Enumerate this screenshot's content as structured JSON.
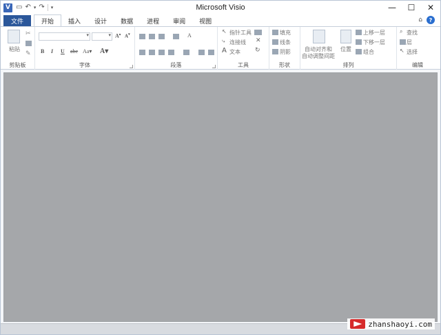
{
  "window": {
    "title": "Microsoft Visio"
  },
  "qat": {
    "app_icon": "V",
    "save_icon": "save-icon",
    "undo_icon": "undo-icon",
    "redo_icon": "redo-icon"
  },
  "window_controls": {
    "minimize": "—",
    "maximize": "☐",
    "close": "✕"
  },
  "tabs": [
    {
      "label": "文件"
    },
    {
      "label": "开始"
    },
    {
      "label": "插入"
    },
    {
      "label": "设计"
    },
    {
      "label": "数据"
    },
    {
      "label": "进程"
    },
    {
      "label": "审阅"
    },
    {
      "label": "视图"
    }
  ],
  "ribbon": {
    "clipboard": {
      "label": "剪贴板",
      "paste": "粘贴"
    },
    "font": {
      "label": "字体"
    },
    "paragraph": {
      "label": "段落"
    },
    "tools": {
      "label": "工具",
      "pointer": "指针工具",
      "connector": "连接线",
      "text": "文本"
    },
    "shape": {
      "label": "形状",
      "fill": "填充",
      "line": "线条",
      "shadow": "阴影"
    },
    "arrange": {
      "label": "排列",
      "auto_align_1": "自动对齐和",
      "auto_align_2": "自动调整间距",
      "position": "位置",
      "bring_forward": "上移一层",
      "send_backward": "下移一层",
      "group": "组合"
    },
    "editing": {
      "label": "编辑",
      "find": "查找",
      "layer": "层",
      "select": "选择"
    }
  },
  "watermark": {
    "text": "zhanshaoyi.com"
  },
  "colors": {
    "file_tab": "#2b579a",
    "canvas": "#a5a7aa"
  }
}
